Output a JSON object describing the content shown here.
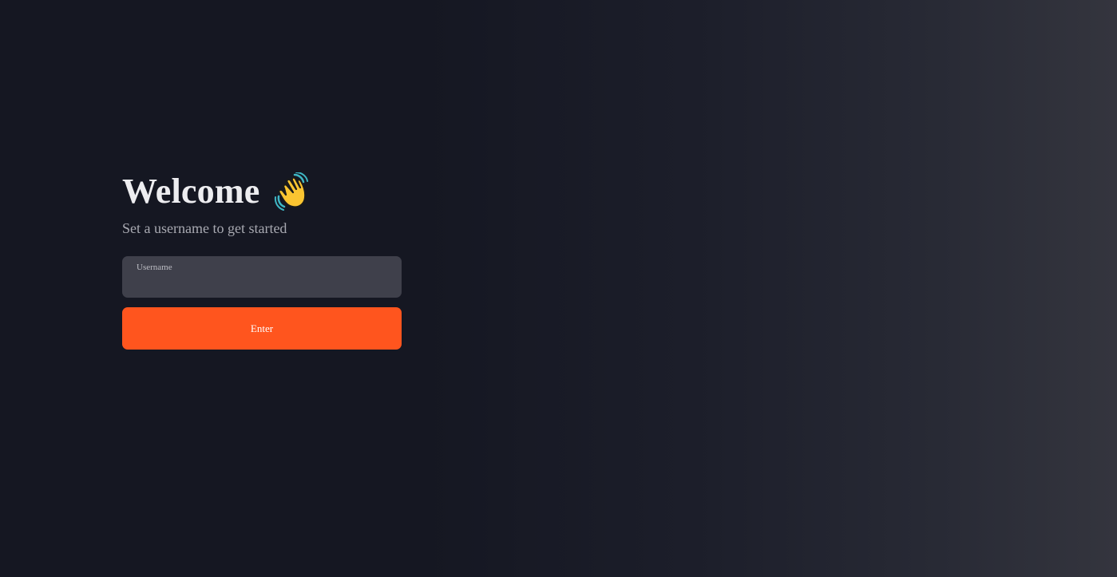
{
  "colors": {
    "background_dark": "#151722",
    "background_light": "#34353e",
    "accent": "#ff551e",
    "field_background": "#3f404b",
    "title_text": "#ededf0",
    "subtitle_text": "#a8a9b1"
  },
  "welcome": {
    "title": "Welcome",
    "title_icon": "waving-hand-icon",
    "subtitle": "Set a username to get started"
  },
  "form": {
    "username": {
      "label": "Username",
      "value": "",
      "placeholder": ""
    },
    "submit_label": "Enter"
  }
}
